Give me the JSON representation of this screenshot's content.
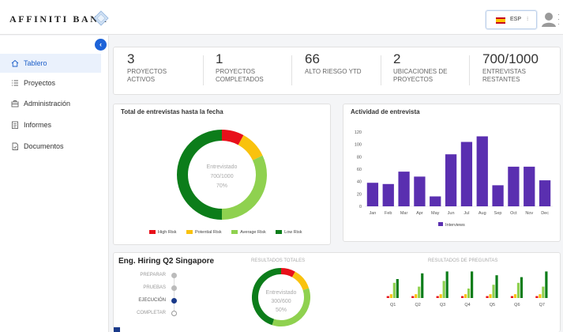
{
  "header": {
    "logo_text": "AFFINITI BANK",
    "language": "ESP",
    "caret": "⁝"
  },
  "sidebar": {
    "items": [
      {
        "label": "Tablero",
        "icon": "home-icon",
        "active": true
      },
      {
        "label": "Proyectos",
        "icon": "list-icon"
      },
      {
        "label": "Administración",
        "icon": "briefcase-icon"
      },
      {
        "label": "Informes",
        "icon": "report-icon"
      },
      {
        "label": "Documentos",
        "icon": "document-icon"
      }
    ]
  },
  "stats": [
    {
      "value": "3",
      "label1": "PROYECTOS",
      "label2": "ACTIVOS"
    },
    {
      "value": "1",
      "label1": "PROYECTOS",
      "label2": "COMPLETADOS"
    },
    {
      "value": "66",
      "label1": "ALTO RIESGO YTD",
      "label2": ""
    },
    {
      "value": "2",
      "label1": "UBICACIONES DE",
      "label2": "PROYECTOS"
    },
    {
      "value": "700/1000",
      "label1": "ENTREVISTAS",
      "label2": "RESTANTES"
    }
  ],
  "donut_card": {
    "title": "Total de entrevistas hasta la fecha",
    "center_line1": "Entrevistado",
    "center_line2": "700/1000",
    "center_line3": "70%",
    "legend": [
      {
        "label": "High Risk",
        "color": "#e8101a"
      },
      {
        "label": "Potential Risk",
        "color": "#f9c20e"
      },
      {
        "label": "Average Risk",
        "color": "#8fd14f"
      },
      {
        "label": "Low Risk",
        "color": "#0c7d1a"
      }
    ]
  },
  "bar_card": {
    "title": "Actividad de entrevista"
  },
  "project": {
    "title": "Eng. Hiring Q2 Singapore",
    "steps": [
      "PREPARAR",
      "PRUEBAS",
      "EJECUCIÓN",
      "COMPLETAR"
    ],
    "totals_header": "RESULTADOS TOTALES",
    "questions_header": "RESULTADOS DE PREGUNTAS",
    "center_line1": "Entrevistado",
    "center_line2": "300/600",
    "center_line3": "50%"
  },
  "chart_data": [
    {
      "type": "pie",
      "title": "Total de entrevistas hasta la fecha",
      "categories": [
        "High Risk",
        "Potential Risk",
        "Average Risk",
        "Low Risk"
      ],
      "values": [
        8,
        10,
        32,
        50
      ],
      "colors": [
        "#e8101a",
        "#f9c20e",
        "#8fd14f",
        "#0c7d1a"
      ]
    },
    {
      "type": "bar",
      "title": "Actividad de entrevista",
      "categories": [
        "Jan",
        "Feb",
        "Mar",
        "Apr",
        "May",
        "Jun",
        "Jul",
        "Aug",
        "Sep",
        "Oct",
        "Nov",
        "Dec"
      ],
      "series": [
        {
          "name": "Interviews",
          "values": [
            38,
            36,
            56,
            48,
            16,
            84,
            104,
            113,
            34,
            64,
            64,
            42
          ]
        }
      ],
      "ylim": [
        0,
        120
      ],
      "yticks": [
        0,
        20,
        40,
        60,
        80,
        100,
        120
      ],
      "color": "#5a2fb0"
    },
    {
      "type": "pie",
      "title": "RESULTADOS TOTALES",
      "categories": [
        "High Risk",
        "Potential Risk",
        "Average Risk",
        "Low Risk"
      ],
      "values": [
        8,
        12,
        35,
        45
      ],
      "colors": [
        "#e8101a",
        "#f9c20e",
        "#8fd14f",
        "#0c7d1a"
      ]
    },
    {
      "type": "bar",
      "title": "RESULTADOS DE PREGUNTAS",
      "categories": [
        "Q1",
        "Q2",
        "Q3",
        "Q4",
        "Q5",
        "Q6",
        "Q7"
      ],
      "series": [
        {
          "values": [
            1,
            1,
            1,
            1,
            1,
            1,
            1
          ],
          "color": "#e8101a"
        },
        {
          "values": [
            2,
            2,
            2,
            2,
            2,
            2,
            2
          ],
          "color": "#f9c20e"
        },
        {
          "values": [
            8,
            6,
            9,
            5,
            7,
            8,
            6
          ],
          "color": "#8fd14f"
        },
        {
          "values": [
            10,
            13,
            14,
            14,
            12,
            11,
            14
          ],
          "color": "#0c7d1a"
        }
      ],
      "ylim": [
        0,
        15
      ]
    }
  ]
}
